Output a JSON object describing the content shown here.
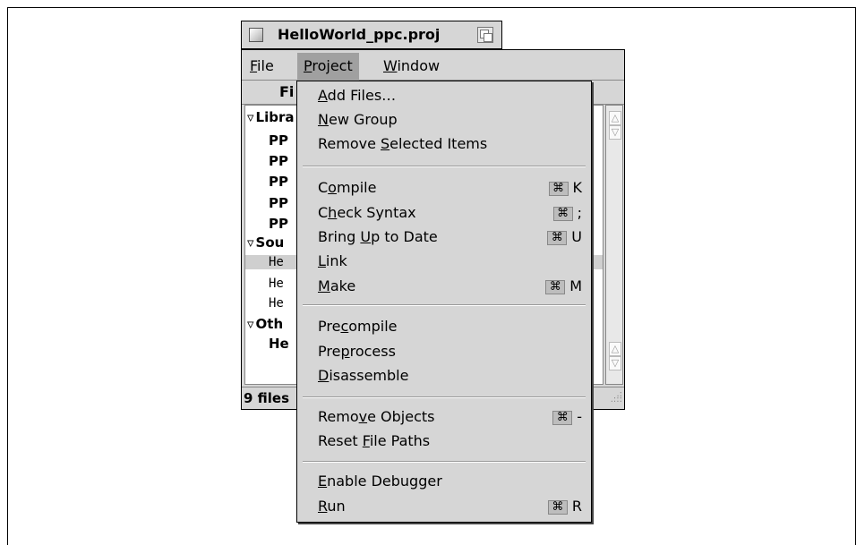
{
  "window": {
    "title": "HelloWorld_ppc.proj",
    "menubar": {
      "file": {
        "pre": "",
        "u": "F",
        "post": "ile"
      },
      "project": {
        "pre": "",
        "u": "P",
        "post": "roject"
      },
      "window": {
        "pre": "",
        "u": "W",
        "post": "indow"
      }
    },
    "column_header": "Fi",
    "rows": [
      {
        "text": "Libra",
        "kind": "group"
      },
      {
        "text": "PP",
        "kind": "bold"
      },
      {
        "text": "PP",
        "kind": "bold"
      },
      {
        "text": "PP",
        "kind": "bold"
      },
      {
        "text": "PP",
        "kind": "bold"
      },
      {
        "text": "PP",
        "kind": "bold"
      },
      {
        "text": "Sou",
        "kind": "group"
      },
      {
        "text": "He",
        "kind": "mono-selected"
      },
      {
        "text": "He",
        "kind": "mono"
      },
      {
        "text": "He",
        "kind": "mono"
      },
      {
        "text": "Oth",
        "kind": "group"
      },
      {
        "text": "He",
        "kind": "bold"
      }
    ],
    "status": "9 files"
  },
  "project_menu": {
    "groups": [
      [
        {
          "pre": "",
          "u": "A",
          "post": "dd Files…",
          "shortcut": ""
        },
        {
          "pre": "",
          "u": "N",
          "post": "ew Group",
          "shortcut": ""
        },
        {
          "pre": "Remove ",
          "u": "S",
          "post": "elected Items",
          "shortcut": ""
        }
      ],
      [
        {
          "pre": "C",
          "u": "o",
          "post": "mpile",
          "shortcut": "K"
        },
        {
          "pre": "C",
          "u": "h",
          "post": "eck Syntax",
          "shortcut": ";"
        },
        {
          "pre": "Bring ",
          "u": "U",
          "post": "p to Date",
          "shortcut": "U"
        },
        {
          "pre": "",
          "u": "L",
          "post": "ink",
          "shortcut": ""
        },
        {
          "pre": "",
          "u": "M",
          "post": "ake",
          "shortcut": "M"
        }
      ],
      [
        {
          "pre": "Pre",
          "u": "c",
          "post": "ompile",
          "shortcut": ""
        },
        {
          "pre": "Pre",
          "u": "p",
          "post": "rocess",
          "shortcut": ""
        },
        {
          "pre": "",
          "u": "D",
          "post": "isassemble",
          "shortcut": ""
        }
      ],
      [
        {
          "pre": "Remo",
          "u": "v",
          "post": "e Objects",
          "shortcut": "-"
        },
        {
          "pre": "Reset ",
          "u": "F",
          "post": "ile Paths",
          "shortcut": ""
        }
      ],
      [
        {
          "pre": "",
          "u": "E",
          "post": "nable Debugger",
          "shortcut": ""
        },
        {
          "pre": "",
          "u": "R",
          "post": "un",
          "shortcut": "R"
        }
      ]
    ],
    "cmd_symbol": "⌘"
  }
}
